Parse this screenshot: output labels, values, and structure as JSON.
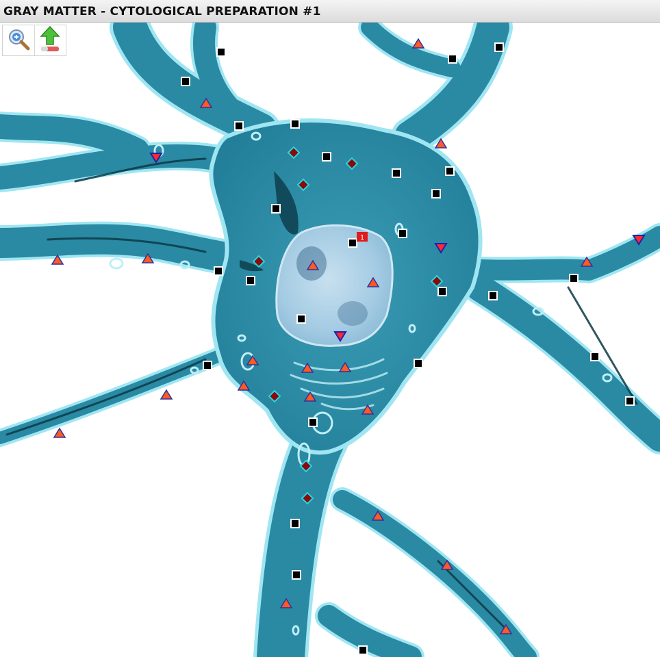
{
  "window": {
    "title": "GRAY MATTER - CYTOLOGICAL PREPARATION #1"
  },
  "toolbar": {
    "zoom_in": "zoom-in-icon",
    "export": "upload-icon"
  },
  "nucleus_badge": {
    "count": "1",
    "color": "#e11b1b"
  },
  "colors": {
    "cytoplasm": "#2b8aa3",
    "cytoplasm_dark": "#0f4f62",
    "nucleus": "#a8cfe6",
    "square_marker": "#000000",
    "triangle_fill": "#ff5a1f",
    "triangle_border": "#3030a0",
    "inverted_triangle_fill": "#ff2a2a",
    "inverted_triangle_border": "#2020b0",
    "diamond_fill": "#8b0a0a",
    "diamond_border": "#27d6e0"
  }
}
